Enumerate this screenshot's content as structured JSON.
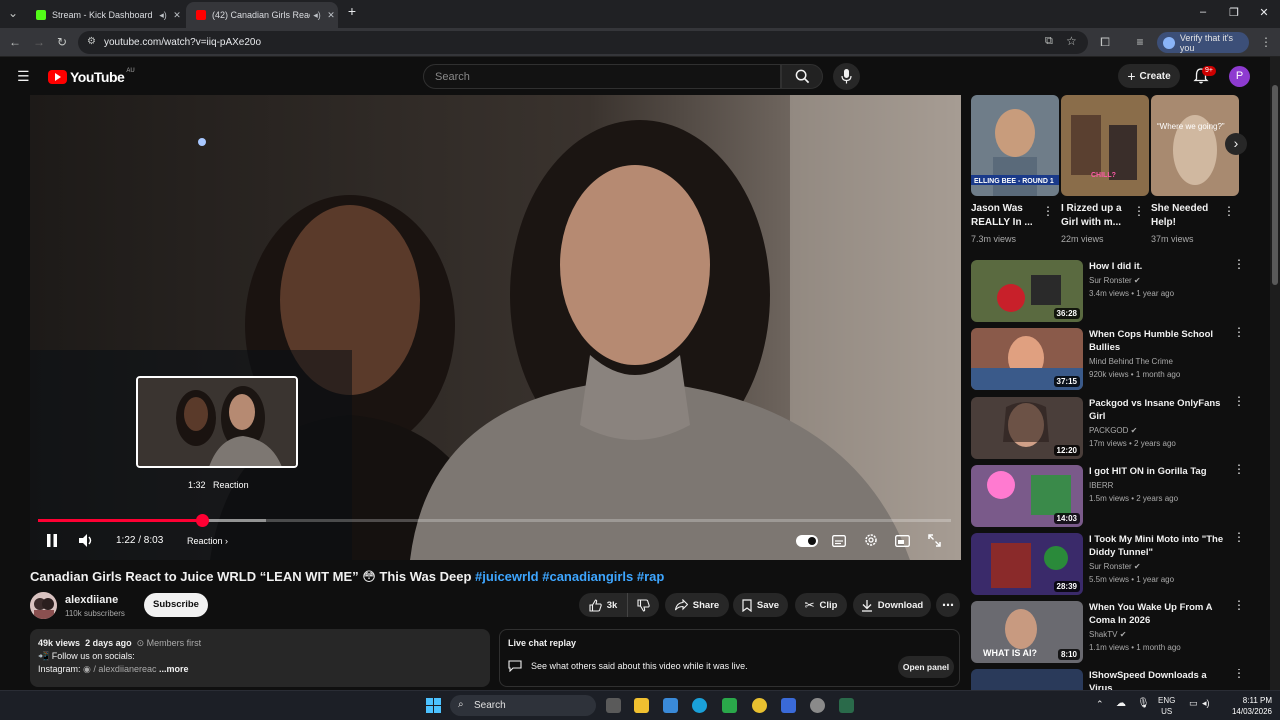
{
  "browser": {
    "tabs": [
      {
        "title": "Stream - Kick Dashboard",
        "favicon_color": "#53fc18",
        "active": false
      },
      {
        "title": "(42) Canadian Girls React to",
        "favicon_color": "#ff0000",
        "active": true
      }
    ],
    "url": "youtube.com/watch?v=iiq-pAXe20o",
    "verify_label": "Verify that it's you"
  },
  "youtube": {
    "logo_text": "YouTube",
    "region": "AU",
    "search_placeholder": "Search",
    "create_label": "Create",
    "notifications": "9+",
    "avatar_letter": "P"
  },
  "player": {
    "seek_hint": "⌃ Pull up for precise seeking",
    "preview_time": "1:32",
    "preview_chapter": "Reaction",
    "current_time": "1:22 / 8:03",
    "chapter": "Reaction",
    "played_fraction": 0.18,
    "loaded_fraction": 0.25,
    "accent": "#ff0033"
  },
  "video": {
    "title": "Canadian Girls React to Juice WRLD “LEAN WIT ME” 😳 This Was Deep",
    "hashtags": "#juicewrld #canadiangirls #rap",
    "channel": "alexdiiane",
    "subscribers": "110k subscribers",
    "subscribe_label": "Subscribe",
    "likes": "3k",
    "share_label": "Share",
    "save_label": "Save",
    "clip_label": "Clip",
    "download_label": "Download"
  },
  "description": {
    "views": "49k views",
    "date": "2 days ago",
    "members": "Members first",
    "line1": "Follow us on socials:",
    "line2_prefix": "Instagram:",
    "line2_handle": "/ alexdiianereac",
    "more": "...more"
  },
  "livechat": {
    "title": "Live chat replay",
    "text": "See what others said about this video while it was live.",
    "button": "Open panel"
  },
  "shorts": [
    {
      "title": "Jason Was REALLY In ...",
      "views": "7.3m views",
      "overlay": "ELLING BEE - ROUND 1",
      "bg": "#6f7d89"
    },
    {
      "title": "I Rizzed up a Girl with m...",
      "views": "22m views",
      "overlay": "CHILL?",
      "bg": "#8a6d4a"
    },
    {
      "title": "She Needed Help!",
      "views": "37m views",
      "overlay": "“Where we going?”",
      "bg": "#a88a70"
    }
  ],
  "recommendations": [
    {
      "title": "How I did it.",
      "channel": "Sur Ronster",
      "meta": "3.4m views • 1 year ago",
      "duration": "36:28",
      "bg": "#5a6a40"
    },
    {
      "title": "When Cops Humble School Bullies",
      "channel": "Mind Behind The Crime",
      "meta": "920k views • 1 month ago",
      "duration": "37:15",
      "bg": "#8a5a4a"
    },
    {
      "title": "Packgod vs Insane OnlyFans Girl",
      "channel": "PACKGOD",
      "meta": "17m views • 2 years ago",
      "duration": "12:20",
      "bg": "#4a3e3a"
    },
    {
      "title": "I got HIT ON in Gorilla Tag",
      "channel": "IBERR",
      "meta": "1.5m views • 2 years ago",
      "duration": "14:03",
      "bg": "#7a5a8a"
    },
    {
      "title": "I Took My Mini Moto into \"The Diddy Tunnel\"",
      "channel": "Sur Ronster",
      "meta": "5.5m views • 1 year ago",
      "duration": "28:39",
      "bg": "#3a2a6a"
    },
    {
      "title": "When You Wake Up From A Coma In 2026",
      "channel": "ShakTV",
      "meta": "1.1m views • 1 month ago",
      "duration": "8:10",
      "bg": "#6a6a70",
      "overlay": "WHAT IS AI?"
    },
    {
      "title": "IShowSpeed Downloads a Virus",
      "channel": "",
      "meta": "",
      "duration": "",
      "bg": "#2a3a5a"
    }
  ],
  "taskbar": {
    "search": "Search",
    "lang1": "ENG",
    "lang2": "US",
    "time": "8:11 PM",
    "date": "14/03/2026"
  }
}
